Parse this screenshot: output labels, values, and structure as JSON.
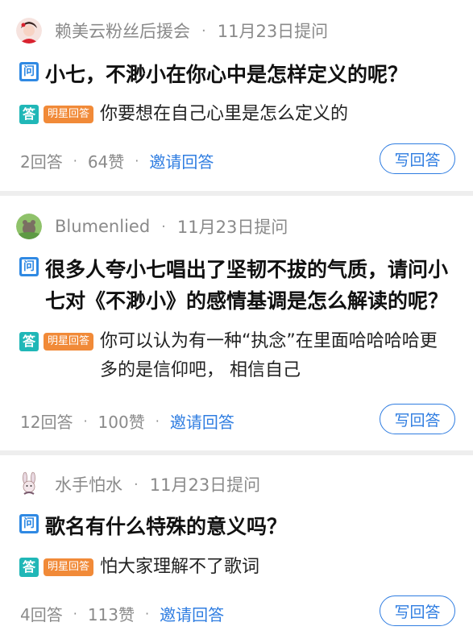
{
  "questions": [
    {
      "user": "赖美云粉丝后援会",
      "time": "11月23日提问",
      "question_badge": "问",
      "question": "小七，不渺小在你心中是怎样定义的呢？",
      "answer_badge": "答",
      "star_label": "明星回答",
      "answer": "你要想在自己心里是怎么定义的",
      "answers_count": "2回答",
      "likes": "64赞",
      "invite": "邀请回答",
      "write": "写回答"
    },
    {
      "user": "Blumenlied",
      "time": "11月23日提问",
      "question_badge": "问",
      "question": "很多人夸小七唱出了坚韧不拔的气质，请问小七对《不渺小》的感情基调是怎么解读的呢？",
      "answer_badge": "答",
      "star_label": "明星回答",
      "answer": "你可以认为有一种“执念”在里面哈哈哈哈更多的是信仰吧， 相信自己",
      "answers_count": "12回答",
      "likes": "100赞",
      "invite": "邀请回答",
      "write": "写回答"
    },
    {
      "user": "水手怕水",
      "time": "11月23日提问",
      "question_badge": "问",
      "question": "歌名有什么特殊的意义吗？",
      "answer_badge": "答",
      "star_label": "明星回答",
      "answer": "怕大家理解不了歌词",
      "answers_count": "4回答",
      "likes": "113赞",
      "invite": "邀请回答",
      "write": "写回答"
    }
  ],
  "separator": "·",
  "colors": {
    "accent_blue": "#2f7de1",
    "answer_teal": "#20b7b7",
    "star_orange": "#f18a38",
    "meta_gray": "#8a8a8a"
  },
  "icons": {
    "question_badge": "question-badge-icon",
    "answer_badge": "answer-badge-icon"
  }
}
